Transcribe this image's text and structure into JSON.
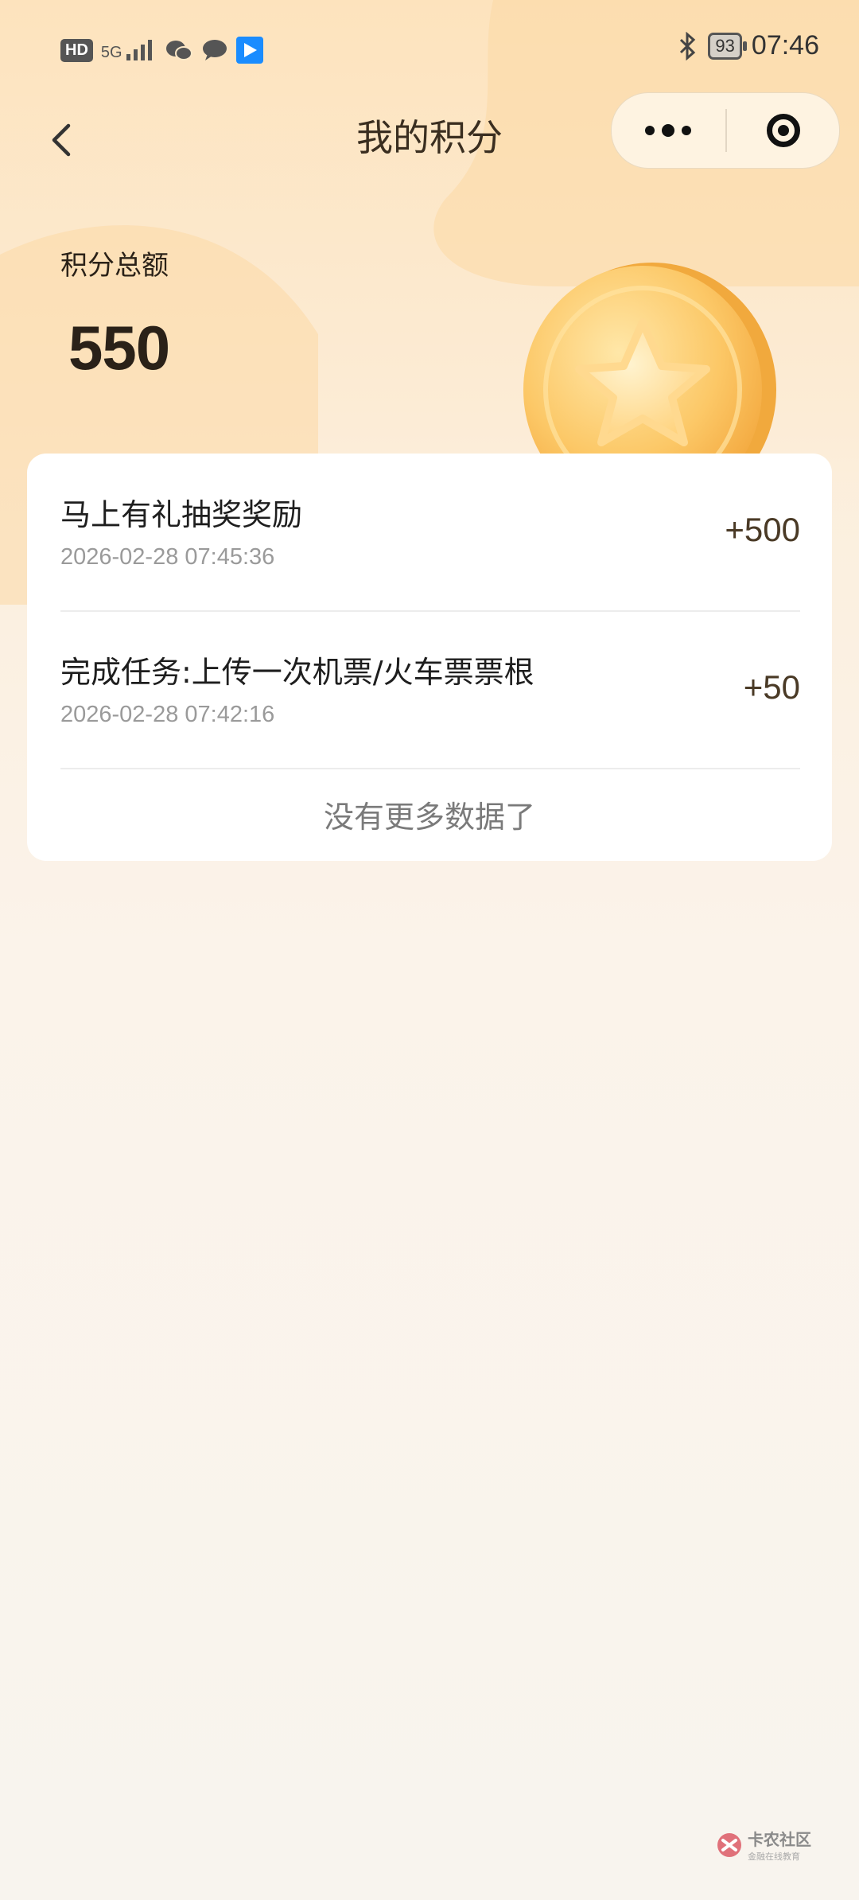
{
  "status_bar": {
    "hd_badge": "HD",
    "signal_label": "5G",
    "battery": "93",
    "time": "07:46",
    "icons": [
      "hd-icon",
      "signal-icon",
      "wechat-icon",
      "message-icon",
      "app-notification-icon",
      "bluetooth-icon",
      "battery-icon"
    ]
  },
  "nav": {
    "title": "我的积分",
    "back_icon": "chevron-left-icon",
    "more_icon": "more-dots-icon",
    "close_icon": "target-close-icon"
  },
  "summary": {
    "label": "积分总额",
    "total": "550"
  },
  "records": [
    {
      "title": "马上有礼抽奖奖励",
      "time": "2026-02-28 07:45:36",
      "points": "+500"
    },
    {
      "title": "完成任务:上传一次机票/火车票票根",
      "time": "2026-02-28 07:42:16",
      "points": "+50"
    }
  ],
  "list_footer": "没有更多数据了",
  "watermark": {
    "name": "卡农社区",
    "sub": "金融在线教育"
  },
  "colors": {
    "header_gradient_top": "#fde8c7",
    "page_background": "#f8f4ee",
    "points_color": "#4a3a26",
    "coin_gold": "#fbc56a"
  }
}
